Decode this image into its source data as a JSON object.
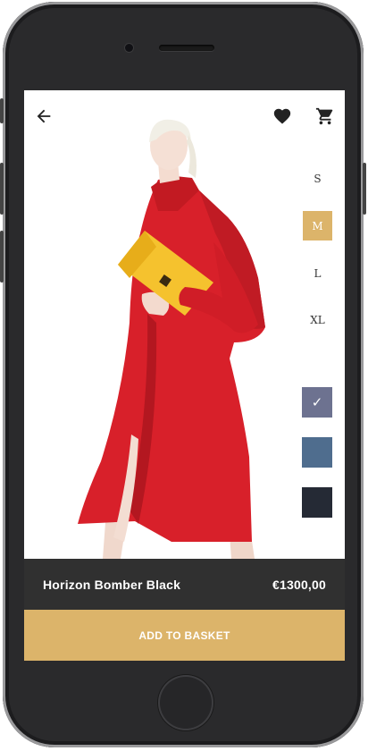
{
  "icons": {
    "back": "arrow-left-icon",
    "favorite": "heart-icon",
    "cart": "shopping-cart-icon"
  },
  "sizes": [
    {
      "label": "S",
      "selected": false
    },
    {
      "label": "M",
      "selected": true
    },
    {
      "label": "L",
      "selected": false
    },
    {
      "label": "XL",
      "selected": false
    }
  ],
  "colors": [
    {
      "hex": "#6d7290",
      "selected": true,
      "check": "✓"
    },
    {
      "hex": "#4f6d8e",
      "selected": false
    },
    {
      "hex": "#252a35",
      "selected": false
    }
  ],
  "product": {
    "name": "Horizon Bomber Black",
    "price": "€1300,00"
  },
  "add_to_basket_label": "ADD TO BASKET",
  "theme": {
    "accent": "#dcb46a",
    "info_bar": "#303030",
    "coat": "#d8202a",
    "clutch": "#f5c22e"
  }
}
